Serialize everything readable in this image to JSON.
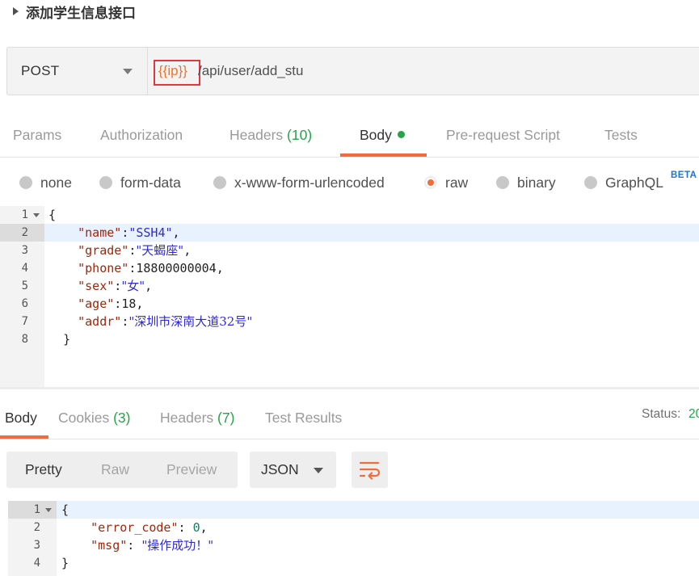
{
  "title": "添加学生信息接口",
  "request": {
    "method": "POST",
    "url_variable": "{{ip}}",
    "url_path": "/api/user/add_stu"
  },
  "request_tabs": {
    "params": "Params",
    "authorization": "Authorization",
    "headers": "Headers",
    "headers_count": "(10)",
    "body": "Body",
    "prerequest": "Pre-request Script",
    "tests": "Tests"
  },
  "body_types": {
    "none": "none",
    "form_data": "form-data",
    "urlencoded": "x-www-form-urlencoded",
    "raw": "raw",
    "binary": "binary",
    "graphql": "GraphQL",
    "beta": "BETA",
    "selected": "raw"
  },
  "request_body": {
    "line_numbers": [
      "1",
      "2",
      "3",
      "4",
      "5",
      "6",
      "7",
      "8"
    ],
    "open_brace": "{",
    "close_brace": "}",
    "fields": [
      {
        "key": "\"name\"",
        "value": "\"SSH4\"",
        "sep": ":",
        "end": ","
      },
      {
        "key": "\"grade\"",
        "value": "\"天蝎座\"",
        "sep": ":",
        "end": ","
      },
      {
        "key": "\"phone\"",
        "value": "18800000004",
        "sep": ":",
        "end": ","
      },
      {
        "key": "\"sex\"",
        "value": "\"女\"",
        "sep": ":",
        "end": ","
      },
      {
        "key": "\"age\"",
        "value": "18",
        "sep": ":",
        "end": ","
      },
      {
        "key": "\"addr\"",
        "value": "\"深圳市深南大道32号\"",
        "sep": ":",
        "end": ""
      }
    ]
  },
  "response_tabs": {
    "body": "Body",
    "cookies": "Cookies",
    "cookies_count": "(3)",
    "headers": "Headers",
    "headers_count": "(7)",
    "test_results": "Test Results",
    "status_label": "Status:",
    "status_value": "20"
  },
  "response_toolbar": {
    "pretty": "Pretty",
    "raw": "Raw",
    "preview": "Preview",
    "format": "JSON"
  },
  "response_body": {
    "line_numbers": [
      "1",
      "2",
      "3",
      "4"
    ],
    "open_brace": "{",
    "close_brace": "}",
    "error_code_key": "\"error_code\"",
    "error_code_value": "0",
    "msg_key": "\"msg\"",
    "msg_value": "\"操作成功！\""
  },
  "colors": {
    "accent": "#f26b3a",
    "count_green": "#26a34a",
    "highlight_red": "#e0383e",
    "json_key": "#a1260c",
    "json_string": "#2e2ad6"
  }
}
